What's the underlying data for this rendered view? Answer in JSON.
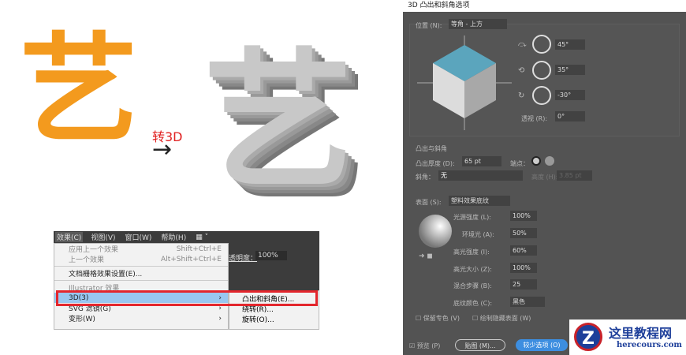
{
  "illustration": {
    "glyph": "艺",
    "arrow_label": "转3D",
    "arrow": "→"
  },
  "menubar": {
    "items": [
      "效果(C)",
      "视图(V)",
      "窗口(W)",
      "帮助(H)"
    ],
    "layout_icon": "layout-grid-icon"
  },
  "toolbar": {
    "opacity_label": "透明度：",
    "opacity_value": "100%"
  },
  "effect_menu": {
    "items": [
      {
        "label": "应用上一个效果",
        "shortcut": "Shift+Ctrl+E"
      },
      {
        "label": "上一个效果",
        "shortcut": "Alt+Shift+Ctrl+E"
      },
      {
        "label": "文档栅格效果设置(E)...",
        "shortcut": ""
      },
      {
        "label": "Illustrator 效果",
        "shortcut": ""
      },
      {
        "label": "3D(3)",
        "shortcut": "›"
      },
      {
        "label": "SVG 滤镜(G)",
        "shortcut": "›"
      },
      {
        "label": "变形(W)",
        "shortcut": "›"
      }
    ]
  },
  "submenu": {
    "items": [
      "凸出和斜角(E)...",
      "绕转(R)...",
      "旋转(O)..."
    ]
  },
  "dialog": {
    "title": "3D 凸出和斜角选项",
    "position_label": "位置 (N):",
    "position_value": "等角 - 上方",
    "rot_x": "45°",
    "rot_y": "35°",
    "rot_z": "-30°",
    "perspective_label": "透视 (R):",
    "perspective_value": "0°",
    "extrude_group": "凸出与斜角",
    "depth_label": "凸出厚度 (D):",
    "depth_value": "65 pt",
    "cap_label": "端点：",
    "bevel_label": "斜角：",
    "bevel_value": "无",
    "height_label": "高度 (H):",
    "height_value": "3.85 pt",
    "surface_label": "表面 (S):",
    "surface_value": "塑料效果底纹",
    "light_intensity_label": "光源强度 (L):",
    "light_intensity": "100%",
    "ambient_label": "环境光 (A):",
    "ambient": "50%",
    "highlight_intensity_label": "高光强度 (I):",
    "highlight_intensity": "60%",
    "highlight_size_label": "高光大小 (Z):",
    "highlight_size": "100%",
    "blend_steps_label": "混合步骤 (B):",
    "blend_steps": "25",
    "shade_color_label": "底纹颜色 (C):",
    "shade_color": "黑色",
    "preserve_spot": "保留专色 (V)",
    "draw_hidden": "绘制隐藏表面 (W)",
    "preview": "预览 (P)",
    "map_button": "贴图 (M)...",
    "fewer_options": "较少选项 (O)"
  },
  "watermark": {
    "name": "这里教程网",
    "url": "herecours.com"
  }
}
